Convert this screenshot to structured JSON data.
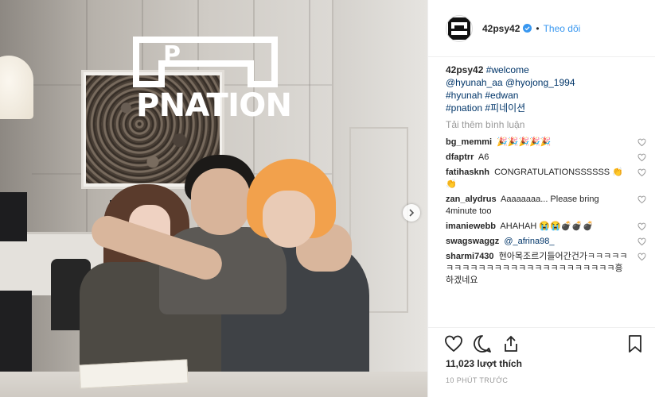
{
  "post": {
    "photo_logo_text": "PNATION",
    "username": "42psy42",
    "follow_separator": "•",
    "follow_label": "Theo dõi",
    "caption": {
      "username": "42psy42",
      "lines": [
        "#welcome",
        "@hyunah_aa @hyojong_1994",
        "#hyunah #edwan",
        "#pnation #피네이션"
      ]
    },
    "load_more_label": "Tải thêm bình luận",
    "comments": [
      {
        "user": "bg_memmi",
        "text": "🎉🎉🎉🎉🎉"
      },
      {
        "user": "dfaptrr",
        "text": "A6"
      },
      {
        "user": "fatihasknh",
        "text": "CONGRATULATIONSSSSSS 👏👏"
      },
      {
        "user": "zan_alydrus",
        "text": "Aaaaaaaa... Please bring 4minute too"
      },
      {
        "user": "imaniewebb",
        "text": "AHAHAH 😭😭💣💣💣"
      },
      {
        "user": "swagswaggz",
        "text": "@_afrina98_"
      },
      {
        "user": "sharmi7430",
        "text": "현아목조르기들어간건가ㅋㅋㅋㅋㅋㅋㅋㅋㅋㅋㅋㅋㅋㅋㅋㅋㅋㅋㅋㅋㅋㅋㅋㅋㅋㅋ흥하겠네요"
      }
    ],
    "likes": "11,023 lượt thích",
    "time_ago": "10 PHÚT TRƯỚC",
    "icons": {
      "like": "heart-icon",
      "comment": "comment-icon",
      "share": "share-icon",
      "save": "bookmark-icon",
      "next": "chevron-right-icon",
      "verified": "verified-badge-icon"
    },
    "colors": {
      "link": "#003569",
      "follow": "#3897f0",
      "muted": "#999999",
      "verified": "#3897f0"
    }
  }
}
